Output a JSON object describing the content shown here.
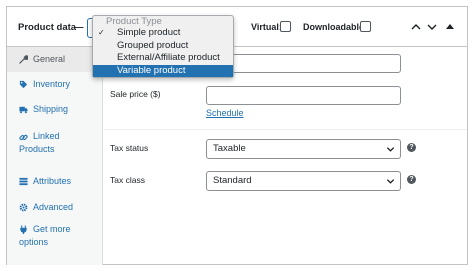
{
  "header": {
    "title": "Product data",
    "dash": "—",
    "virtual_label": "Virtual:",
    "downloadable_label": "Downloadable:"
  },
  "product_type_dropdown": {
    "heading": "Product Type",
    "options": [
      {
        "label": "Simple product",
        "checked": true,
        "highlighted": false
      },
      {
        "label": "Grouped product",
        "checked": false,
        "highlighted": false
      },
      {
        "label": "External/Affiliate product",
        "checked": false,
        "highlighted": false
      },
      {
        "label": "Variable product",
        "checked": false,
        "highlighted": true
      }
    ],
    "check_glyph": "✓"
  },
  "sidebar": {
    "items": [
      {
        "label": "General",
        "icon": "wrench-icon",
        "active": true
      },
      {
        "label": "Inventory",
        "icon": "tag-icon",
        "active": false
      },
      {
        "label": "Shipping",
        "icon": "truck-icon",
        "active": false
      },
      {
        "label_line1": "Linked",
        "label_line2": "Products",
        "icon": "link-icon",
        "active": false
      },
      {
        "label": "Attributes",
        "icon": "list-icon",
        "active": false
      },
      {
        "label": "Advanced",
        "icon": "gear-icon",
        "active": false
      },
      {
        "label_line1": "Get more",
        "label_line2": "options",
        "icon": "plugin-icon",
        "active": false
      }
    ]
  },
  "general": {
    "regular_price_value": "",
    "sale_price_label": "Sale price ($)",
    "sale_price_value": "",
    "schedule_link": "Schedule",
    "tax_status_label": "Tax status",
    "tax_status_value": "Taxable",
    "tax_class_label": "Tax class",
    "tax_class_value": "Standard",
    "help_glyph": "?"
  },
  "colors": {
    "accent": "#2271b1",
    "border": "#c3c4c7",
    "sidebar_bg": "#f6f7f7",
    "active_tab_bg": "#eaeaea",
    "text": "#1d2327"
  }
}
